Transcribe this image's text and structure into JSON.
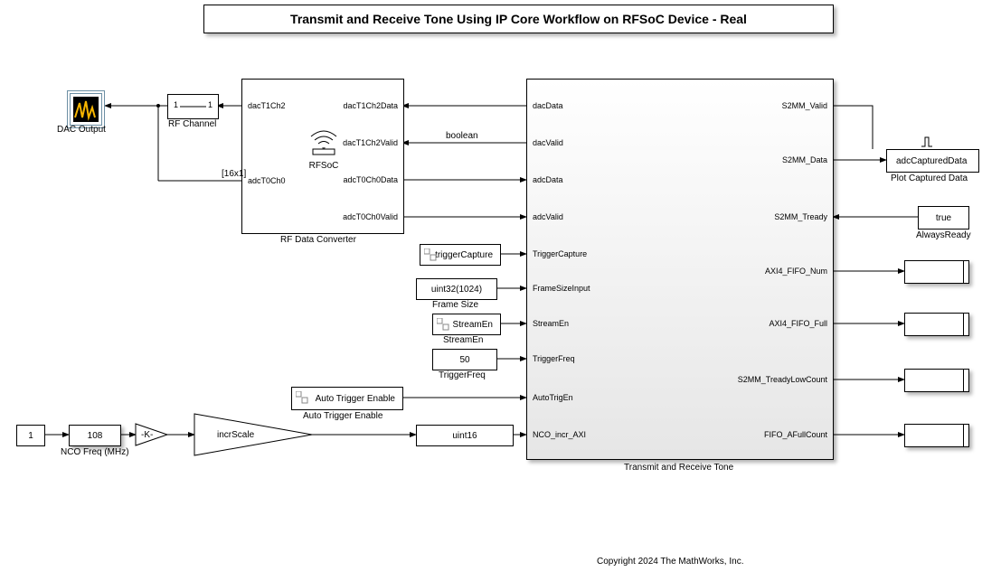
{
  "title": "Transmit and Receive Tone Using IP Core Workflow on RFSoC Device - Real",
  "copyright": "Copyright 2024 The MathWorks, Inc.",
  "dacOutput": {
    "label": "DAC Output"
  },
  "rfChannel": {
    "label": "RF Channel",
    "inPort": "1",
    "outPort": "1"
  },
  "ncoFreq": {
    "label": "NCO Freq (MHz)",
    "const": "1",
    "disp": "108"
  },
  "gainK": {
    "label": "-K-"
  },
  "incrScale": {
    "label": "incrScale"
  },
  "uint16": {
    "label": "uint16"
  },
  "rfdc": {
    "label": "RF Data Converter",
    "inner": "RFSoC",
    "lports": [
      "dacT1Ch2",
      "adcT0Ch0"
    ],
    "rports": [
      "dacT1Ch2Data",
      "dacT1Ch2Valid",
      "adcT0Ch0Data",
      "adcT0Ch0Valid"
    ]
  },
  "bus16": "[16x1]",
  "booleanTag": "boolean",
  "autoTrig": {
    "label": "Auto Trigger Enable",
    "inner": "Auto Trigger Enable"
  },
  "triggerCapture": {
    "label": "triggerCapture"
  },
  "frameSize": {
    "label": "Frame Size",
    "value": "uint32(1024)"
  },
  "streamEn": {
    "label": "StreamEn",
    "value": "StreamEn"
  },
  "triggerFreq": {
    "label": "TriggerFreq",
    "value": "50"
  },
  "mainBlock": {
    "label": "Transmit and Receive Tone",
    "lports": [
      "dacData",
      "dacValid",
      "adcData",
      "adcValid",
      "TriggerCapture",
      "FrameSizeInput",
      "StreamEn",
      "TriggerFreq",
      "AutoTrigEn",
      "NCO_incr_AXI"
    ],
    "rports": [
      "S2MM_Valid",
      "S2MM_Data",
      "S2MM_Tready",
      "AXI4_FIFO_Num",
      "AXI4_FIFO_Full",
      "S2MM_TreadyLowCount",
      "FIFO_AFullCount"
    ]
  },
  "plotBlock": {
    "label": "Plot Captured Data",
    "port": "adcCapturedData"
  },
  "alwaysReady": {
    "label": "AlwaysReady",
    "value": "true"
  }
}
